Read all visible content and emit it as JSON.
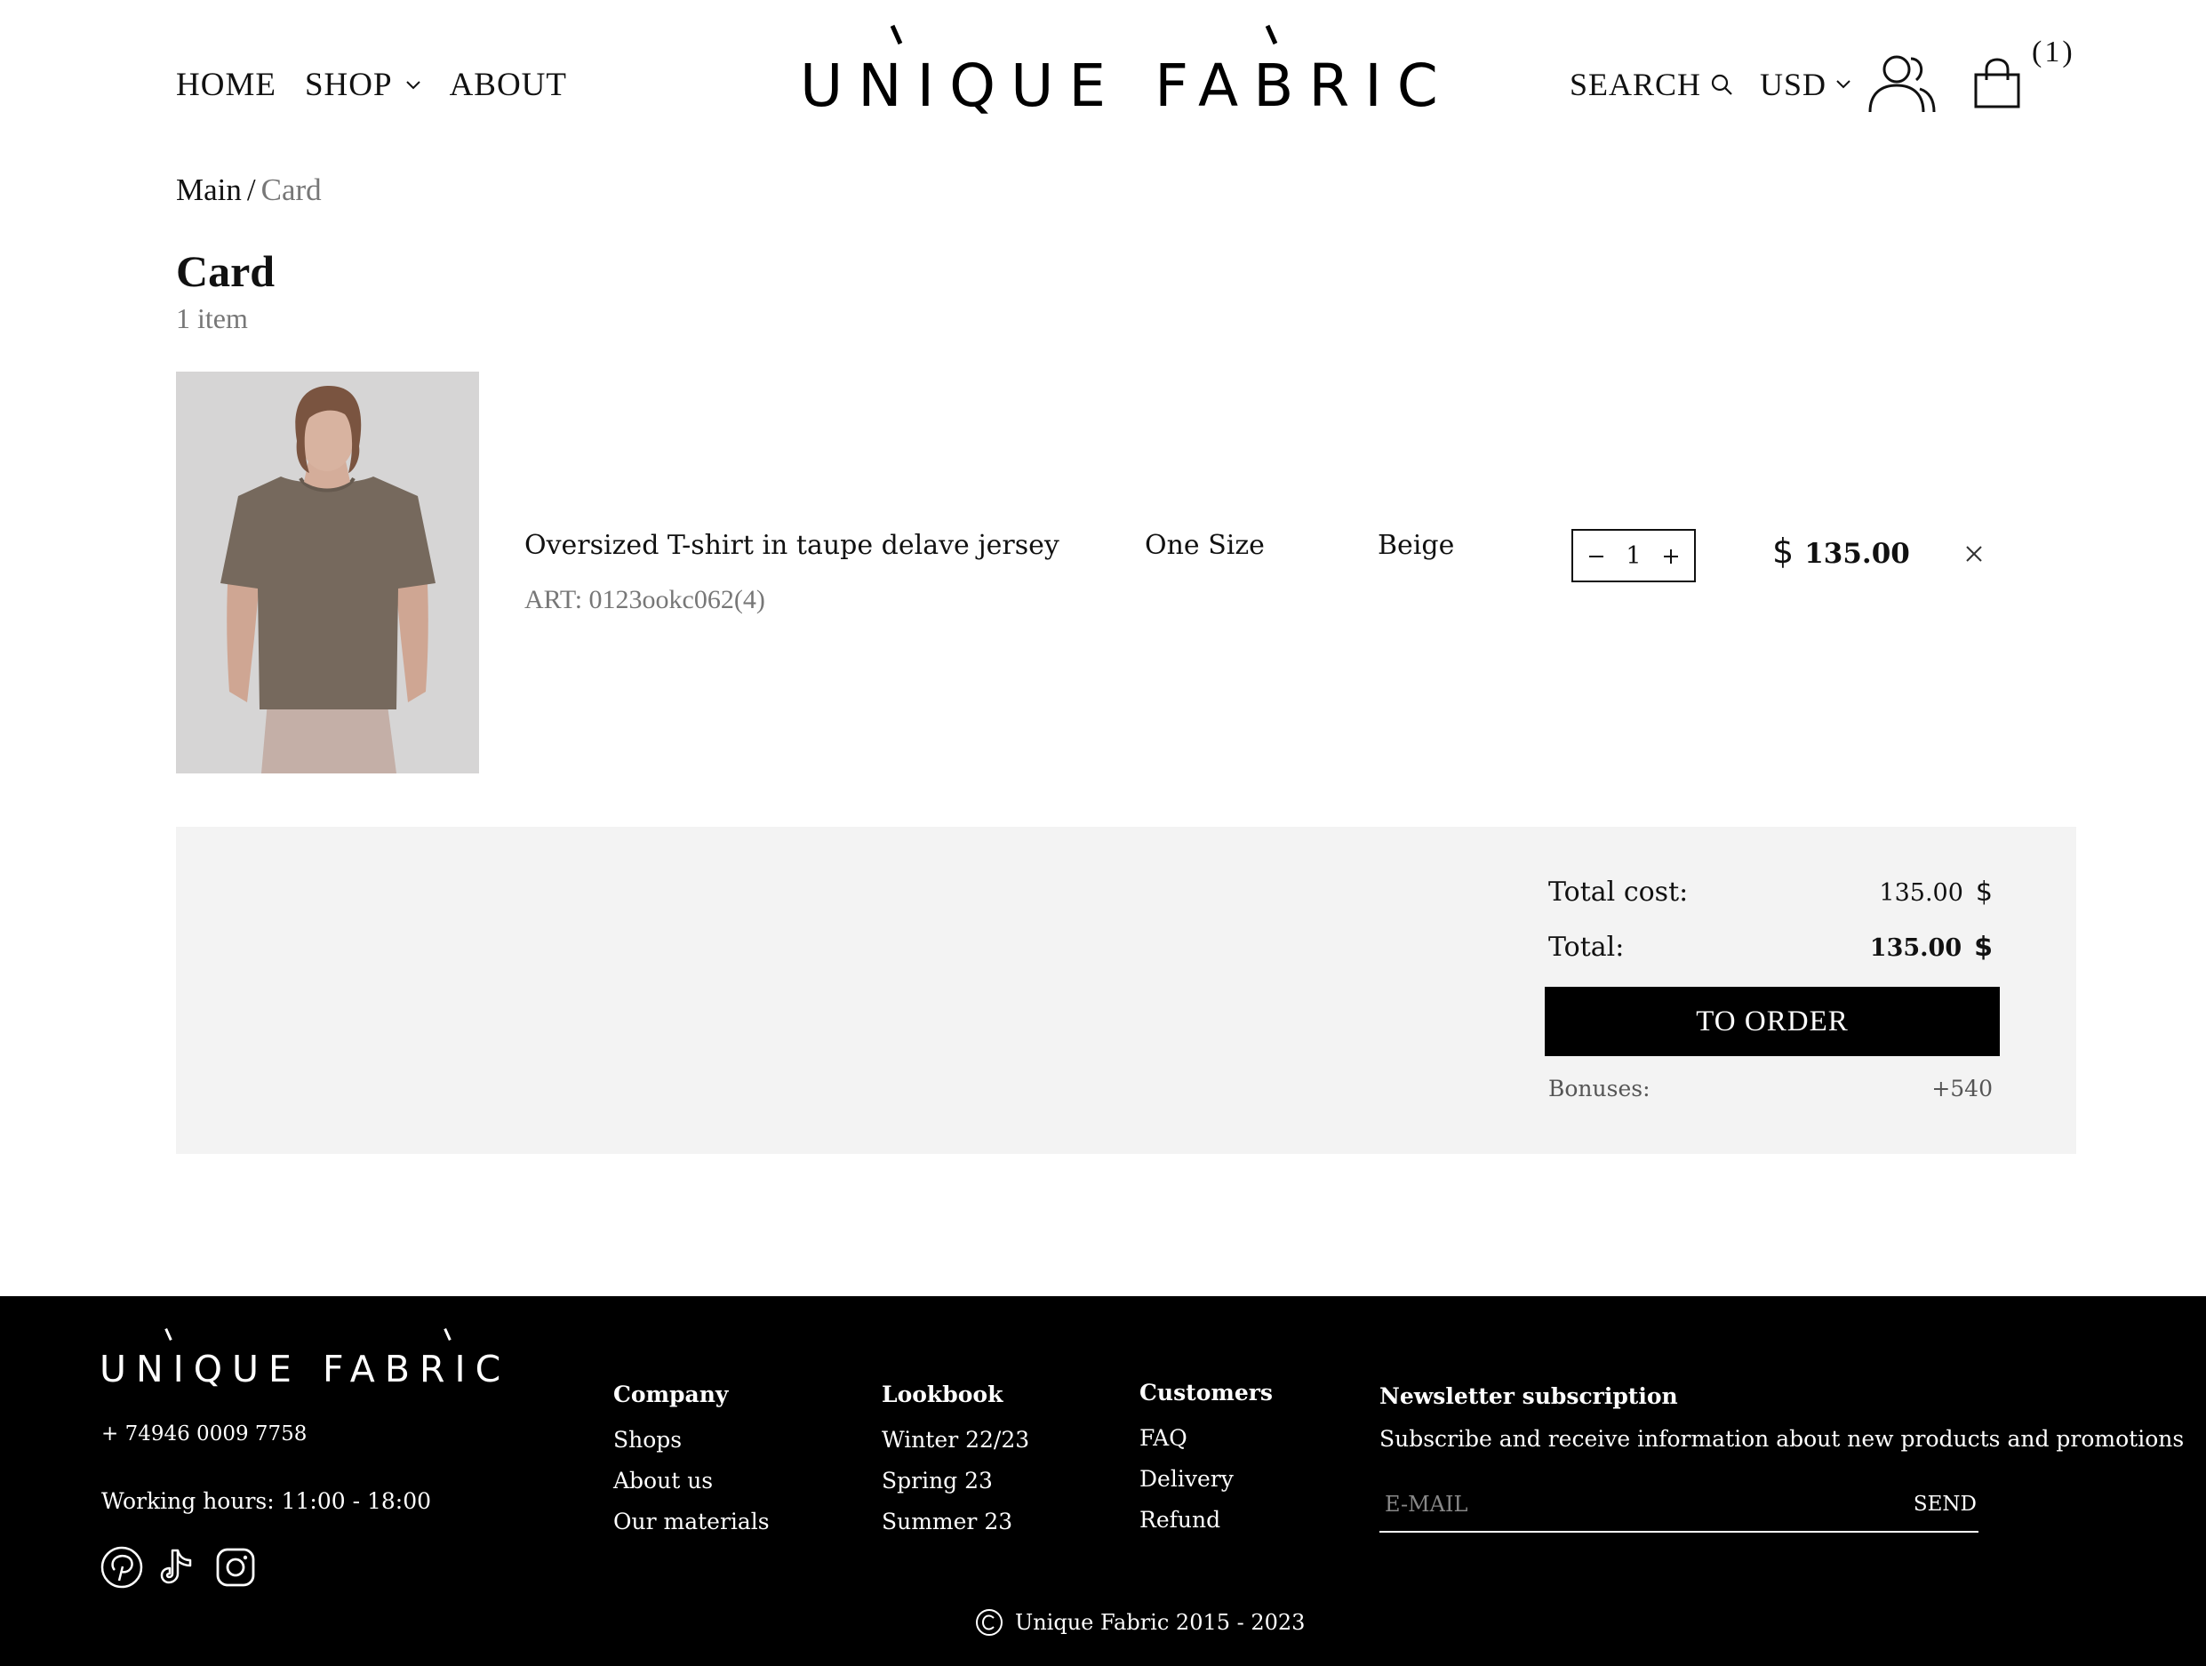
{
  "header": {
    "nav": {
      "home": "HOME",
      "shop": "SHOP",
      "about": "ABOUT"
    },
    "logo": "UNIQUE FABRIC",
    "search": "SEARCH",
    "currency": "USD",
    "cart_count": "(1)"
  },
  "breadcrumb": {
    "root": "Main",
    "separator": "/",
    "current": "Card"
  },
  "page": {
    "title": "Card",
    "item_count": "1 item"
  },
  "cart": {
    "items": [
      {
        "name": "Oversized T-shirt in taupe delave jersey",
        "art": "ART: 0123ookc062(4)",
        "size": "One Size",
        "color": "Beige",
        "quantity": "1",
        "currency_symbol": "$",
        "price": "135.00"
      }
    ]
  },
  "summary": {
    "total_cost_label": "Total cost:",
    "total_cost_value": "135.00",
    "total_label": "Total:",
    "total_value": "135.00",
    "currency_symbol": "$",
    "order_button": "TO ORDER",
    "bonuses_label": "Bonuses:",
    "bonuses_value": "+540"
  },
  "footer": {
    "logo": "UNIQUE FABRIC",
    "phone": "+ 74946 0009 7758",
    "hours": "Working hours: 11:00 - 18:00",
    "columns": [
      {
        "title": "Company",
        "items": [
          "Shops",
          "About us",
          "Our materials"
        ]
      },
      {
        "title": "Lookbook",
        "items": [
          "Winter 22/23",
          "Spring 23",
          "Summer 23"
        ]
      },
      {
        "title": "Customers",
        "items": [
          "FAQ",
          "Delivery",
          "Refund"
        ]
      }
    ],
    "newsletter": {
      "title": "Newsletter subscription",
      "text": "Subscribe and receive information about new products and promotions",
      "placeholder": "E-MAIL",
      "send": "SEND"
    },
    "copyright": "Unique Fabric 2015 - 2023"
  },
  "colors": {
    "accent": "#000000",
    "summary_bg": "#f3f3f3",
    "muted": "#777777"
  }
}
